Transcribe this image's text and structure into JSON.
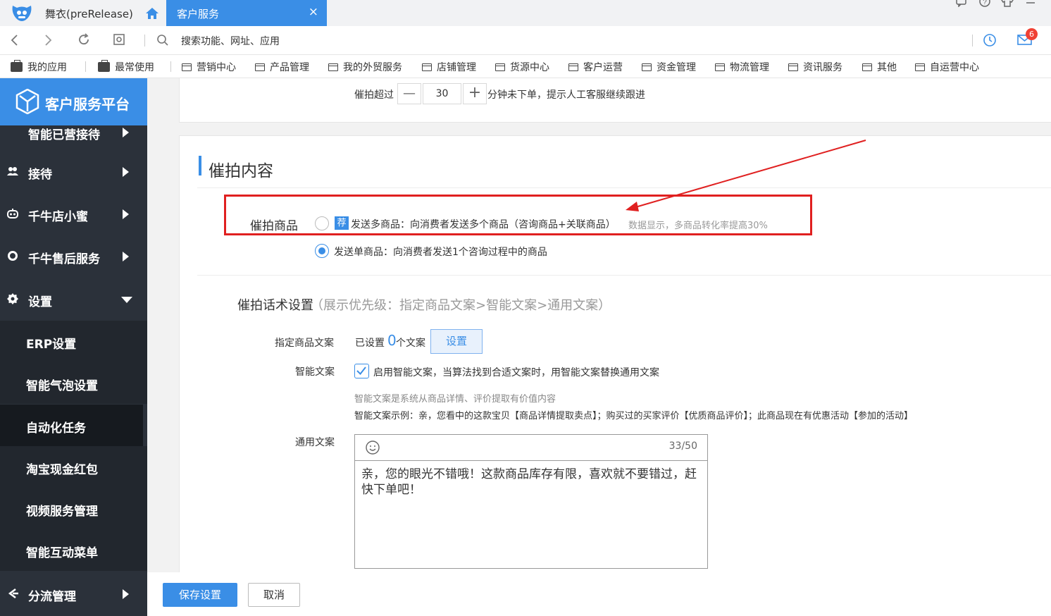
{
  "window": {
    "app_title": "舞衣(preRelease)",
    "active_tab": "客户服务",
    "tab_close": "×",
    "icons": [
      "feedback-icon",
      "help-icon",
      "skin-icon",
      "menu-icon"
    ]
  },
  "navbar": {
    "address_placeholder": "搜索功能、网址、应用",
    "message_badge": "6"
  },
  "bookmarks": {
    "items": [
      "我的应用",
      "最常使用",
      "营销中心",
      "产品管理",
      "我的外贸服务",
      "店铺管理",
      "货源中心",
      "客户运营",
      "资金管理",
      "物流管理",
      "资讯服务",
      "其他",
      "自运营中心"
    ]
  },
  "sidebar": {
    "platform_title": "客户服务平台",
    "cut_item": "智能已营接待",
    "items": {
      "reception": "接待",
      "qianniu_xiaomi": "千牛店小蜜",
      "aftersale": "千牛售后服务",
      "settings": "设置",
      "erp": "ERP设置",
      "bubble": "智能气泡设置",
      "automation": "自动化任务",
      "redpacket": "淘宝现金红包",
      "video": "视频服务管理",
      "menu": "智能互动菜单",
      "routing": "分流管理"
    }
  },
  "top_card": {
    "prefix": "催拍超过",
    "minus": "—",
    "minutes": "30",
    "plus": "+",
    "suffix": "分钟未下单，提示人工客服继续跟进"
  },
  "content": {
    "section_title": "催拍内容",
    "product_label": "催拍商品",
    "rec_badge": "荐",
    "option_multi": "发送多商品：向消费者发送多个商品（咨询商品+关联商品）",
    "option_multi_hint": "数据显示，多商品转化率提高30%",
    "option_single": "发送单商品：向消费者发送1个咨询过程中的商品",
    "script_title": "催拍话术设置",
    "script_hint": "（展示优先级：指定商品文案>智能文案>通用文案）",
    "specified_label": "指定商品文案",
    "specified_prefix": "已设置",
    "specified_count": "0",
    "specified_suffix": "个文案",
    "set_button": "设置",
    "smart_label": "智能文案",
    "smart_checkbox_text": "启用智能文案，当算法找到合适文案时，用智能文案替换通用文案",
    "smart_desc": "智能文案是系统从商品详情、评价提取有价值内容",
    "smart_example": "智能文案示例：亲，您看中的这款宝贝【商品详情提取卖点】；购买过的买家评价【优质商品评价】；此商品现在有优惠活动【参加的活动】",
    "general_label": "通用文案",
    "editor_count": "33/50",
    "editor_text": "亲，您的眼光不错哦！这款商品库存有限，喜欢就不要错过，赶快下单吧！"
  },
  "footer": {
    "save": "保存设置",
    "cancel": "取消"
  },
  "colors": {
    "accent": "#3a8ee6",
    "sidebar_bg": "#2b313a",
    "annotation_red": "#e02020"
  }
}
